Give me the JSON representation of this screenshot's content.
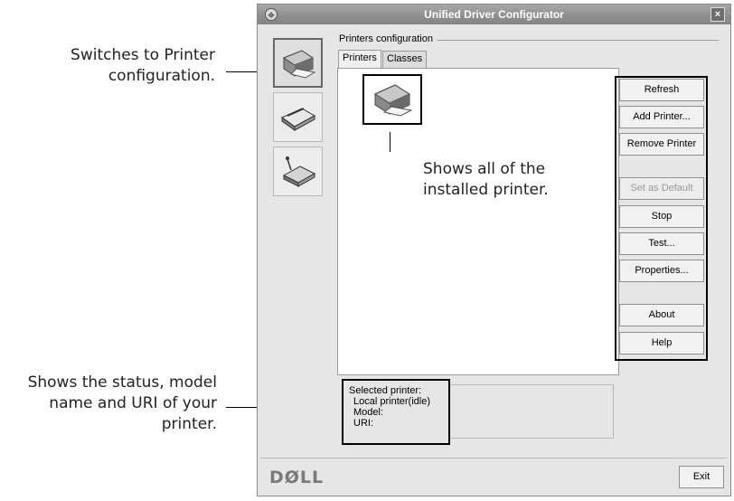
{
  "window": {
    "title": "Unified Driver Configurator",
    "close_glyph": "×",
    "brand": "DØLL"
  },
  "sidebar": {
    "items": [
      {
        "name": "printer-config",
        "icon": "printer-icon",
        "active": true
      },
      {
        "name": "scanner-config",
        "icon": "scanner-icon",
        "active": false
      },
      {
        "name": "port-config",
        "icon": "port-icon",
        "active": false
      }
    ]
  },
  "main": {
    "group_title": "Printers configuration",
    "tabs": [
      {
        "label": "Printers",
        "active": true
      },
      {
        "label": "Classes",
        "active": false
      }
    ]
  },
  "buttons": [
    {
      "label": "Refresh",
      "enabled": true
    },
    {
      "label": "Add Printer...",
      "enabled": true
    },
    {
      "label": "Remove Printer",
      "enabled": true
    },
    {
      "label": "Set as Default",
      "enabled": false
    },
    {
      "label": "Stop",
      "enabled": true
    },
    {
      "label": "Test...",
      "enabled": true
    },
    {
      "label": "Properties...",
      "enabled": true
    },
    {
      "label": "About",
      "enabled": true
    },
    {
      "label": "Help",
      "enabled": true
    }
  ],
  "status": {
    "heading": "Selected printer:",
    "state": "Local printer(idle)",
    "model_label": "Model:",
    "uri_label": "URI:"
  },
  "footer": {
    "exit_label": "Exit"
  },
  "callouts": {
    "printer_config": [
      "Switches to Printer",
      "configuration."
    ],
    "installed": [
      "Shows all of the",
      "installed printer."
    ],
    "status": [
      "Shows the status, model",
      "name and URI of your",
      "printer."
    ]
  }
}
